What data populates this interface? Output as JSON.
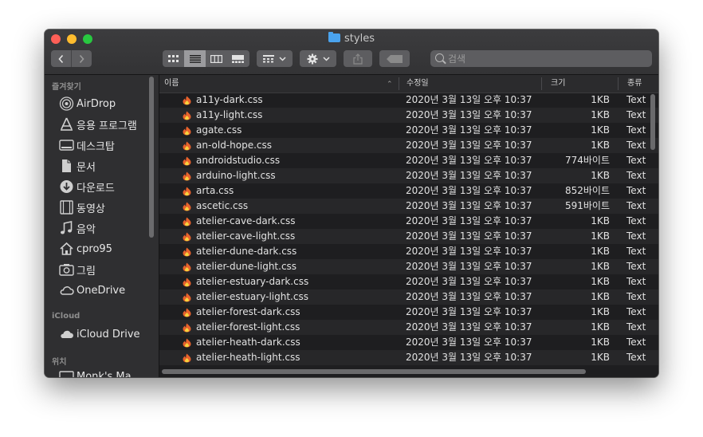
{
  "window": {
    "title": "styles",
    "search_placeholder": "검색"
  },
  "icons": {
    "back": "chevron-left-icon",
    "forward": "chevron-right-icon",
    "views": [
      "icon-view-icon",
      "list-view-icon",
      "column-view-icon",
      "gallery-view-icon"
    ],
    "group": "group-icon",
    "action": "gear-icon",
    "share": "share-icon",
    "tag": "tag-icon",
    "search": "search-icon",
    "file": "css-file-icon"
  },
  "colors": {
    "close": "#fe5f57",
    "minimize": "#febc2e",
    "maximize": "#28c840",
    "folder": "#4aa3ee",
    "file_icon": "#e8622c"
  },
  "sidebar": {
    "favorites_label": "즐겨찾기",
    "favorites": [
      {
        "label": "AirDrop",
        "icon": "airdrop-icon"
      },
      {
        "label": "응용 프로그램",
        "icon": "applications-icon"
      },
      {
        "label": "데스크탑",
        "icon": "desktop-icon"
      },
      {
        "label": "문서",
        "icon": "documents-icon"
      },
      {
        "label": "다운로드",
        "icon": "downloads-icon"
      },
      {
        "label": "동영상",
        "icon": "movies-icon"
      },
      {
        "label": "음악",
        "icon": "music-icon"
      },
      {
        "label": "cpro95",
        "icon": "home-icon"
      },
      {
        "label": "그림",
        "icon": "pictures-icon"
      },
      {
        "label": "OneDrive",
        "icon": "cloud-icon"
      }
    ],
    "icloud_label": "iCloud",
    "icloud": [
      {
        "label": "iCloud Drive",
        "icon": "icloud-icon"
      }
    ],
    "locations_label": "위치",
    "locations": [
      {
        "label": "Monk's Ma",
        "icon": "computer-icon"
      }
    ]
  },
  "columns": {
    "name": "이름",
    "date": "수정일",
    "size": "크기",
    "kind": "종류"
  },
  "files": [
    {
      "name": "a11y-dark.css",
      "date": "2020년 3월 13일 오후 10:37",
      "size": "1KB",
      "kind": "Text"
    },
    {
      "name": "a11y-light.css",
      "date": "2020년 3월 13일 오후 10:37",
      "size": "1KB",
      "kind": "Text"
    },
    {
      "name": "agate.css",
      "date": "2020년 3월 13일 오후 10:37",
      "size": "1KB",
      "kind": "Text"
    },
    {
      "name": "an-old-hope.css",
      "date": "2020년 3월 13일 오후 10:37",
      "size": "1KB",
      "kind": "Text"
    },
    {
      "name": "androidstudio.css",
      "date": "2020년 3월 13일 오후 10:37",
      "size": "774바이트",
      "kind": "Text"
    },
    {
      "name": "arduino-light.css",
      "date": "2020년 3월 13일 오후 10:37",
      "size": "1KB",
      "kind": "Text"
    },
    {
      "name": "arta.css",
      "date": "2020년 3월 13일 오후 10:37",
      "size": "852바이트",
      "kind": "Text"
    },
    {
      "name": "ascetic.css",
      "date": "2020년 3월 13일 오후 10:37",
      "size": "591바이트",
      "kind": "Text"
    },
    {
      "name": "atelier-cave-dark.css",
      "date": "2020년 3월 13일 오후 10:37",
      "size": "1KB",
      "kind": "Text"
    },
    {
      "name": "atelier-cave-light.css",
      "date": "2020년 3월 13일 오후 10:37",
      "size": "1KB",
      "kind": "Text"
    },
    {
      "name": "atelier-dune-dark.css",
      "date": "2020년 3월 13일 오후 10:37",
      "size": "1KB",
      "kind": "Text"
    },
    {
      "name": "atelier-dune-light.css",
      "date": "2020년 3월 13일 오후 10:37",
      "size": "1KB",
      "kind": "Text"
    },
    {
      "name": "atelier-estuary-dark.css",
      "date": "2020년 3월 13일 오후 10:37",
      "size": "1KB",
      "kind": "Text"
    },
    {
      "name": "atelier-estuary-light.css",
      "date": "2020년 3월 13일 오후 10:37",
      "size": "1KB",
      "kind": "Text"
    },
    {
      "name": "atelier-forest-dark.css",
      "date": "2020년 3월 13일 오후 10:37",
      "size": "1KB",
      "kind": "Text"
    },
    {
      "name": "atelier-forest-light.css",
      "date": "2020년 3월 13일 오후 10:37",
      "size": "1KB",
      "kind": "Text"
    },
    {
      "name": "atelier-heath-dark.css",
      "date": "2020년 3월 13일 오후 10:37",
      "size": "1KB",
      "kind": "Text"
    },
    {
      "name": "atelier-heath-light.css",
      "date": "2020년 3월 13일 오후 10:37",
      "size": "1KB",
      "kind": "Text"
    }
  ]
}
